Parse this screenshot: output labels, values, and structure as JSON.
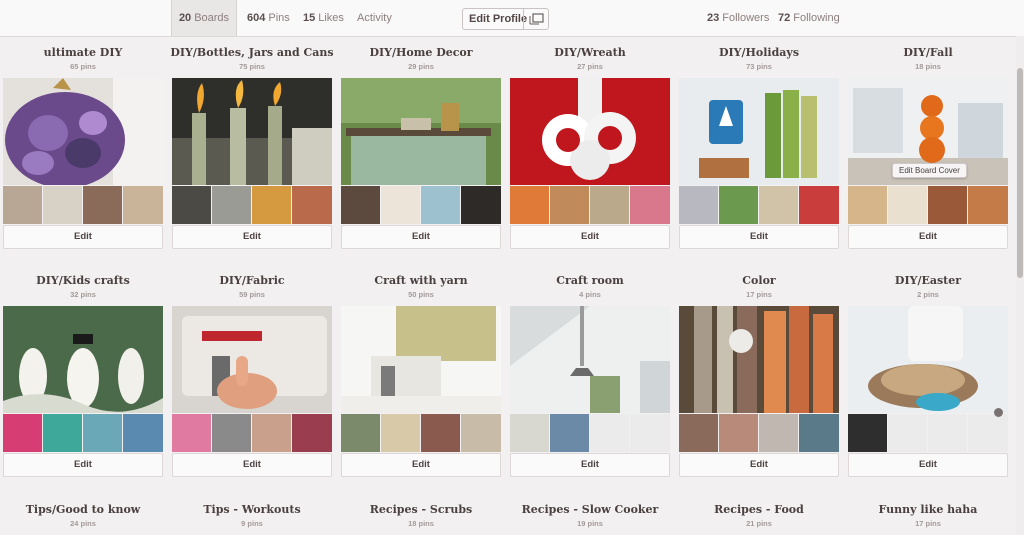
{
  "tabs": {
    "boards": {
      "count": "20",
      "label": "Boards"
    },
    "pins": {
      "count": "604",
      "label": "Pins"
    },
    "likes": {
      "count": "15",
      "label": "Likes"
    },
    "activity": {
      "label": "Activity"
    },
    "followers": {
      "count": "23",
      "label": "Followers"
    },
    "following": {
      "count": "72",
      "label": "Following"
    }
  },
  "edit_profile": {
    "label": "Edit Profile"
  },
  "tooltip": "Edit Board Cover",
  "edit_label": "Edit",
  "boards": [
    {
      "title": "ultimate DIY",
      "pins": "65 pins",
      "cover": "purple-shell-pumpkin",
      "thumbs": [
        "#b9a795",
        "#d8d2c6",
        "#8a6a58",
        "#c9b49a"
      ]
    },
    {
      "title": "DIY/Bottles, Jars and Cans",
      "pins": "75 pins",
      "cover": "bottle-torches",
      "thumbs": [
        "#4b4a44",
        "#9b9b96",
        "#d59a3f",
        "#b86a4a"
      ]
    },
    {
      "title": "DIY/Home Decor",
      "pins": "29 pins",
      "cover": "painted-dresser",
      "thumbs": [
        "#5b4a3d",
        "#ece4d8",
        "#9ec1cf",
        "#2e2a27"
      ]
    },
    {
      "title": "DIY/Wreath",
      "pins": "27 pins",
      "cover": "snowflake-wreath",
      "thumbs": [
        "#e07a38",
        "#c08a5a",
        "#bba98c",
        "#d9778c"
      ]
    },
    {
      "title": "DIY/Holidays",
      "pins": "73 pins",
      "cover": "tree-stamps",
      "thumbs": [
        "#b8b8c0",
        "#6b9a4e",
        "#d0c3a8",
        "#c93d3d"
      ]
    },
    {
      "title": "DIY/Fall",
      "pins": "18 pins",
      "cover": "welcome-pumpkins",
      "thumbs": [
        "#d6b58a",
        "#e9e0d0",
        "#9a5a3a",
        "#c47b48"
      ]
    },
    {
      "title": "DIY/Kids crafts",
      "pins": "32 pins",
      "cover": "snowmen-feet",
      "thumbs": [
        "#d63d72",
        "#3ea89a",
        "#6aa8b8",
        "#5a8ab0"
      ]
    },
    {
      "title": "DIY/Fabric",
      "pins": "59 pins",
      "cover": "sewing-machine",
      "thumbs": [
        "#e07aa0",
        "#8a8a8a",
        "#c8a08c",
        "#9a3d4e"
      ]
    },
    {
      "title": "Craft with yarn",
      "pins": "50 pins",
      "cover": "white-sewing-machine",
      "thumbs": [
        "#7a8a6a",
        "#d8c9a8",
        "#8a5a4e",
        "#c8bca8"
      ]
    },
    {
      "title": "Craft room",
      "pins": "4 pins",
      "cover": "bright-room",
      "thumbs": [
        "#d8d8d0",
        "#6a8aa8",
        "#ecebeb",
        "#ecebeb"
      ]
    },
    {
      "title": "Color",
      "pins": "17 pins",
      "cover": "ribbons-spools",
      "thumbs": [
        "#8a6a5a",
        "#b88a7a",
        "#c0b8b0",
        "#5a7a8a"
      ]
    },
    {
      "title": "DIY/Easter",
      "pins": "2 pins",
      "cover": "egg-nest",
      "thumbs": [
        "#2e2e2e",
        "#ecebeb",
        "#ecebeb",
        "#ecebeb"
      ]
    },
    {
      "title": "Tips/Good to know",
      "pins": "24 pins"
    },
    {
      "title": "Tips - Workouts",
      "pins": "9 pins"
    },
    {
      "title": "Recipes - Scrubs",
      "pins": "18 pins"
    },
    {
      "title": "Recipes - Slow Cooker",
      "pins": "19 pins"
    },
    {
      "title": "Recipes - Food",
      "pins": "21 pins"
    },
    {
      "title": "Funny like haha",
      "pins": "17 pins"
    }
  ]
}
